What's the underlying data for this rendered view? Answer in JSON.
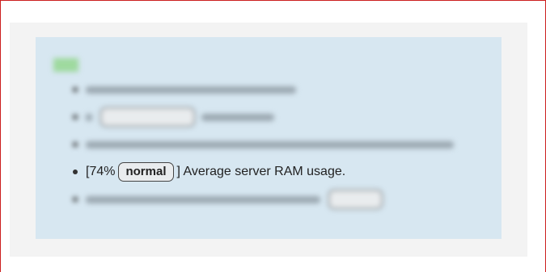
{
  "statistics_item": {
    "value": "74%",
    "badge": "normal",
    "description": "] Average server RAM usage.",
    "open_bracket": "[ "
  }
}
